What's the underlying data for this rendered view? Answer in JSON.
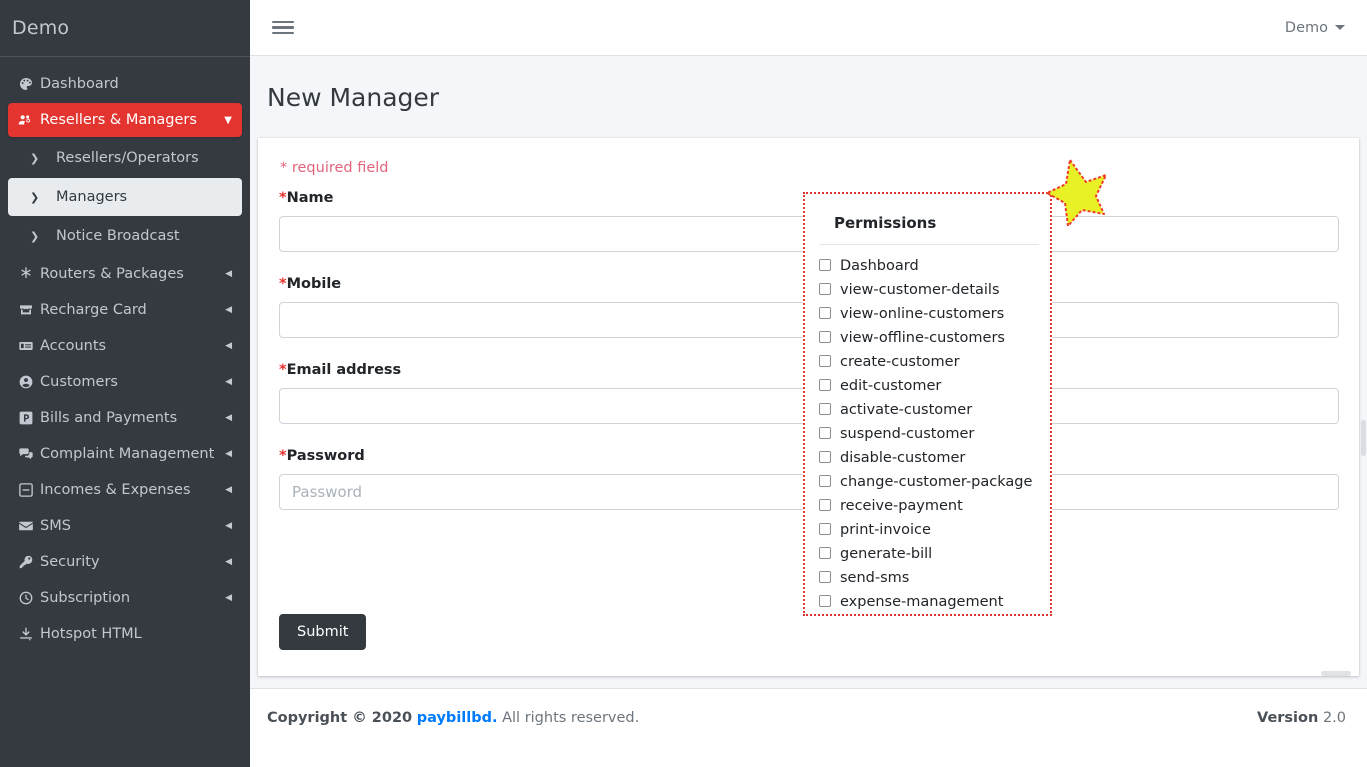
{
  "brand": {
    "title": "Demo"
  },
  "topbar": {
    "menu_icon": "hamburger-icon",
    "user_label": "Demo",
    "user_caret_icon": "chevron-down-icon"
  },
  "sidebar": {
    "items": [
      {
        "label": "Dashboard",
        "icon": "palette-icon",
        "state": "normal",
        "indicator": "none"
      },
      {
        "label": "Resellers & Managers",
        "icon": "users-cog-icon",
        "state": "active",
        "indicator": "caret-down-icon"
      },
      {
        "label": "Resellers/Operators",
        "icon": "chevron-right-icon",
        "state": "sub",
        "indicator": "none"
      },
      {
        "label": "Managers",
        "icon": "chevron-right-icon",
        "state": "sub-selected",
        "indicator": "none"
      },
      {
        "label": "Notice Broadcast",
        "icon": "chevron-right-icon",
        "state": "sub",
        "indicator": "none"
      },
      {
        "label": "Routers & Packages",
        "icon": "asterisk-icon",
        "state": "normal",
        "indicator": "caret-left-icon"
      },
      {
        "label": "Recharge Card",
        "icon": "store-icon",
        "state": "normal",
        "indicator": "caret-left-icon"
      },
      {
        "label": "Accounts",
        "icon": "money-check-icon",
        "state": "normal",
        "indicator": "caret-left-icon"
      },
      {
        "label": "Customers",
        "icon": "user-circle-icon",
        "state": "normal",
        "indicator": "caret-left-icon"
      },
      {
        "label": "Bills and Payments",
        "icon": "parking-p-icon",
        "state": "normal",
        "indicator": "caret-left-icon"
      },
      {
        "label": "Complaint Management",
        "icon": "comments-icon",
        "state": "normal",
        "indicator": "caret-left-icon"
      },
      {
        "label": "Incomes & Expenses",
        "icon": "minus-square-icon",
        "state": "normal",
        "indicator": "caret-left-icon"
      },
      {
        "label": "SMS",
        "icon": "envelope-icon",
        "state": "normal",
        "indicator": "caret-left-icon"
      },
      {
        "label": "Security",
        "icon": "key-icon",
        "state": "normal",
        "indicator": "caret-left-icon"
      },
      {
        "label": "Subscription",
        "icon": "clock-icon",
        "state": "normal",
        "indicator": "caret-left-icon"
      },
      {
        "label": "Hotspot HTML",
        "icon": "download-icon",
        "state": "normal",
        "indicator": "none"
      }
    ]
  },
  "page": {
    "title": "New Manager"
  },
  "form": {
    "required_note": "* required field",
    "fields": [
      {
        "label": "Name",
        "required_mark": "*",
        "value": "",
        "placeholder": ""
      },
      {
        "label": "Mobile",
        "required_mark": "*",
        "value": "",
        "placeholder": ""
      },
      {
        "label": "Email address",
        "required_mark": "*",
        "value": "",
        "placeholder": ""
      },
      {
        "label": "Password",
        "required_mark": "*",
        "value": "",
        "placeholder": "Password"
      }
    ],
    "submit_label": "Submit"
  },
  "permissions": {
    "title": "Permissions",
    "items": [
      {
        "label": "Dashboard",
        "checked": false
      },
      {
        "label": "view-customer-details",
        "checked": false
      },
      {
        "label": "view-online-customers",
        "checked": false
      },
      {
        "label": "view-offline-customers",
        "checked": false
      },
      {
        "label": "create-customer",
        "checked": false
      },
      {
        "label": "edit-customer",
        "checked": false
      },
      {
        "label": "activate-customer",
        "checked": false
      },
      {
        "label": "suspend-customer",
        "checked": false
      },
      {
        "label": "disable-customer",
        "checked": false
      },
      {
        "label": "change-customer-package",
        "checked": false
      },
      {
        "label": "receive-payment",
        "checked": false
      },
      {
        "label": "print-invoice",
        "checked": false
      },
      {
        "label": "generate-bill",
        "checked": false
      },
      {
        "label": "send-sms",
        "checked": false
      },
      {
        "label": "expense-management",
        "checked": false
      }
    ]
  },
  "annotation": {
    "shape": "star-marker",
    "fill": "#e8f125",
    "stroke": "#ef3b2c"
  },
  "footer": {
    "copyright_prefix": "Copyright © 2020",
    "brand_link": "paybillbd.",
    "copyright_suffix": "All rights reserved.",
    "version_label": "Version",
    "version_value": "2.0"
  },
  "colors": {
    "sidebar_bg": "#343a40",
    "accent_red": "#e3342f",
    "page_bg": "#f4f6f9",
    "link_blue": "#007bff"
  }
}
